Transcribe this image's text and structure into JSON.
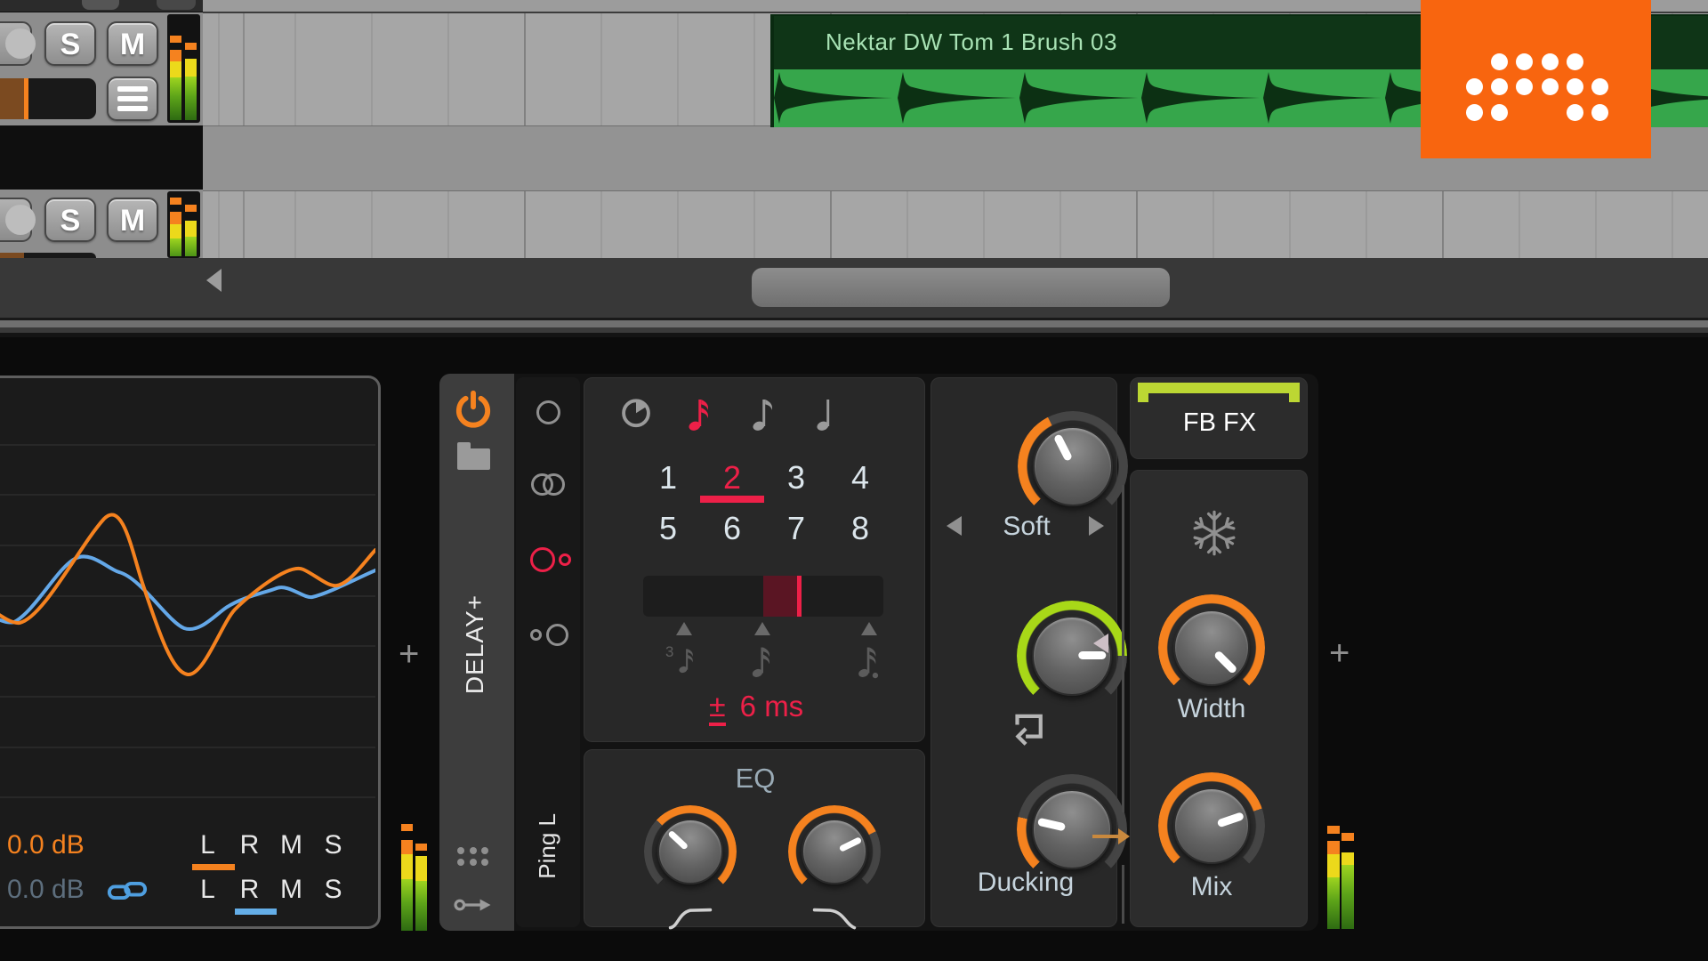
{
  "arrangement": {
    "clip": {
      "name": "Nektar DW Tom 1 Brush 03",
      "color": "#36a64b"
    },
    "tracks": [
      {
        "solo": "S",
        "mute": "M"
      },
      {
        "solo": "S",
        "mute": "M"
      }
    ]
  },
  "left_device": {
    "gain_top": {
      "value": "0.0 dB",
      "channels": [
        "L",
        "R",
        "M",
        "S"
      ],
      "selected": "L"
    },
    "gain_bottom": {
      "value": "0.0 dB",
      "channels": [
        "L",
        "R",
        "M",
        "S"
      ],
      "selected": "R"
    }
  },
  "device_chain": {
    "add_left": "+",
    "add_right": "+"
  },
  "delay": {
    "name": "DELAY+",
    "mode_label": "Ping L",
    "modes": {
      "options": [
        "single",
        "dual",
        "ping-l",
        "ping-r"
      ],
      "selected": "ping-l"
    },
    "sync_divisions": {
      "options": [
        "clock",
        "sixteenth",
        "eighth",
        "quarter"
      ],
      "selected": "sixteenth"
    },
    "sync": {
      "numbers": [
        "1",
        "2",
        "3",
        "4",
        "5",
        "6",
        "7",
        "8"
      ],
      "selected": "2"
    },
    "time_slider": {
      "fill_start_pct": 50,
      "fill_end_pct": 64,
      "markers": [
        "triplet",
        "sixteenth",
        "dotted-sixteenth"
      ]
    },
    "offset": {
      "plusminus": "±",
      "value": "6 ms"
    },
    "eq": {
      "label": "EQ"
    },
    "soft": {
      "label": "Soft"
    },
    "ducking": {
      "label": "Ducking"
    },
    "fbfx": {
      "label": "FB FX"
    },
    "width": {
      "label": "Width"
    },
    "mix": {
      "label": "Mix"
    }
  },
  "knobs": {
    "eq_hp": {
      "pointer_deg": 88,
      "fill": [
        88,
        270
      ],
      "color": "#f5821f"
    },
    "eq_lp": {
      "pointer_deg": 199,
      "fill": [
        0,
        199
      ],
      "color": "#f5821f"
    },
    "soft": {
      "pointer_deg": 108,
      "fill": [
        0,
        108
      ],
      "color": "#f5821f"
    },
    "feedback": {
      "pointer_deg": 225,
      "fill": [
        0,
        225
      ],
      "color": "#a8d818"
    },
    "ducking": {
      "pointer_deg": 58,
      "fill": [
        0,
        58
      ],
      "color": "#f5821f"
    },
    "width": {
      "pointer_deg": 270,
      "fill": [
        0,
        270
      ],
      "color": "#f5821f"
    },
    "mix": {
      "pointer_deg": 206,
      "fill": [
        0,
        206
      ],
      "color": "#f5821f"
    }
  },
  "colors": {
    "accent_orange": "#f5821f",
    "accent_red": "#ed2048",
    "accent_lime": "#a8d818",
    "fbfx_bar": "#bcd733",
    "accent_blue": "#64aee8",
    "clip_green": "#36a64b",
    "logo_orange": "#f8650f"
  },
  "icons": {
    "power-icon": "power arc + stem",
    "folder-icon": "folder shape",
    "remote-controls-icon": "3x2 dot grid",
    "mapping-icon": "key with arrow",
    "clock-icon": "circle with wedge",
    "note-icons": "quarter/eighth/sixteenth notes",
    "link-icon": "chain links",
    "feedback-loop-icon": "box with return arrow",
    "snowflake-icon": "freeze",
    "menu-icon": "hamburger",
    "record-icon": "circle"
  }
}
